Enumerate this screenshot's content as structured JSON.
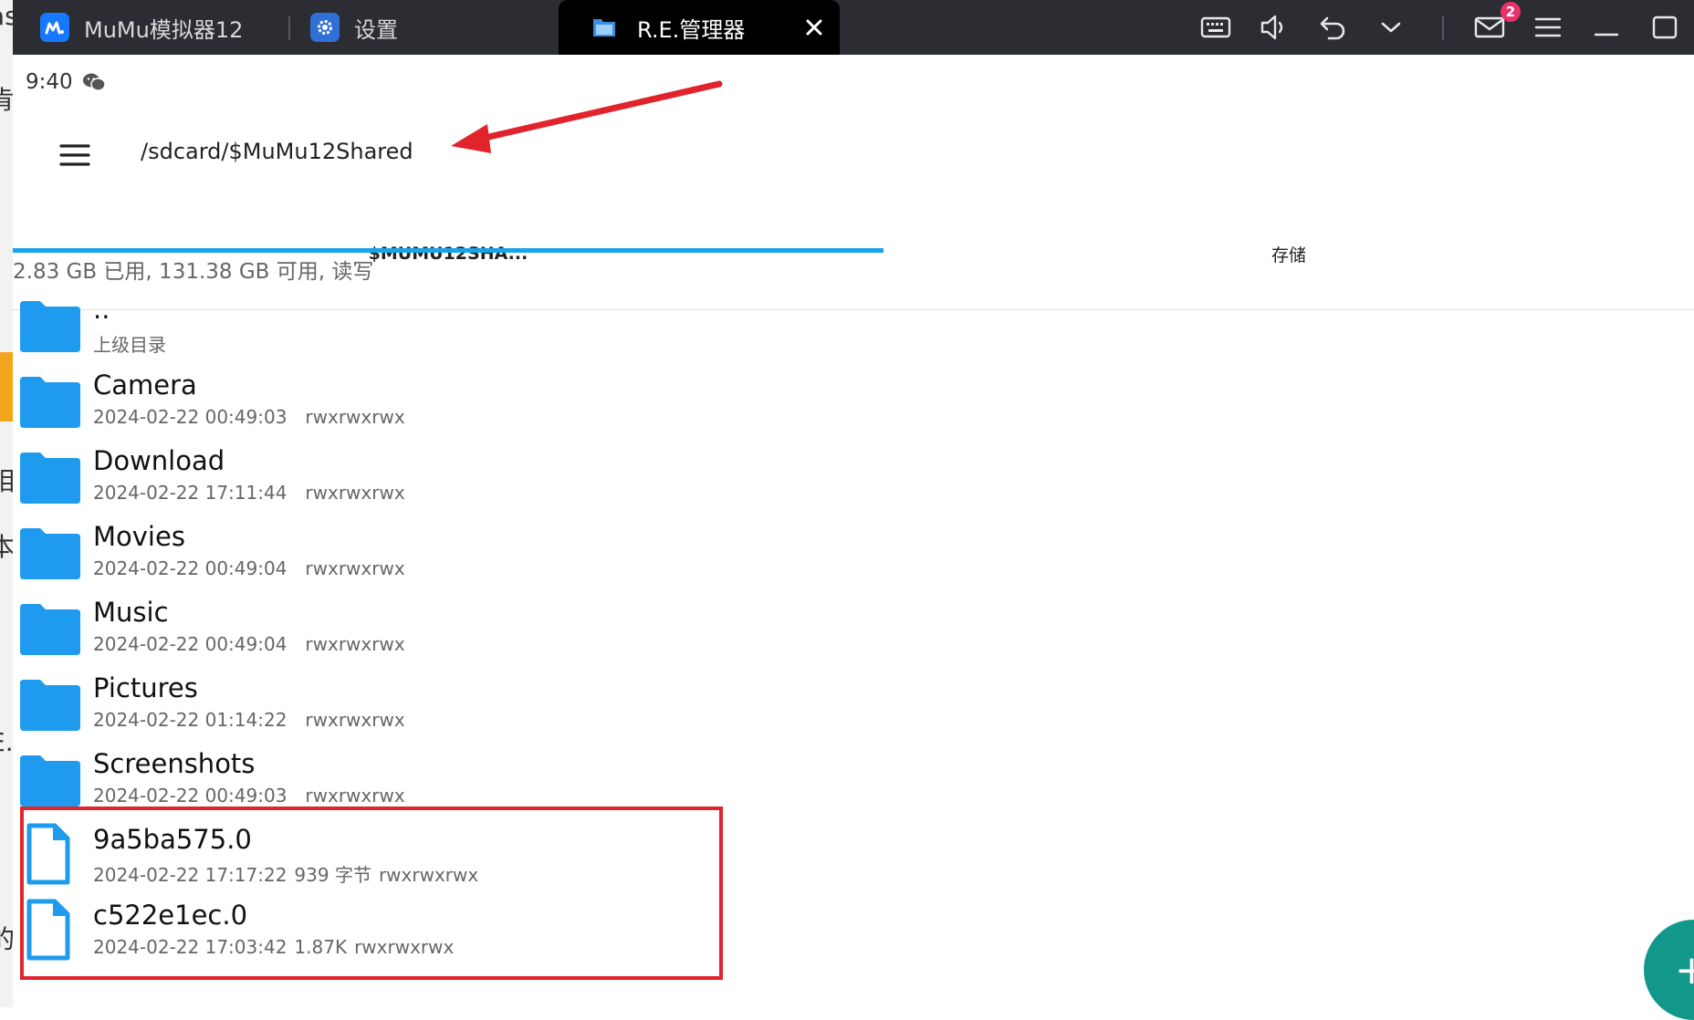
{
  "window": {
    "tabs": [
      {
        "label": "MuMu模拟器12",
        "icon": "mumu-logo-icon"
      },
      {
        "label": "设置",
        "icon": "settings-gear-icon"
      },
      {
        "label": "R.E.管理器",
        "icon": "re-explorer-icon",
        "active": true
      }
    ],
    "toolbar_icons": [
      "keyboard-icon",
      "volume-icon",
      "back-undo-icon",
      "chevron-down-icon",
      "mail-icon",
      "hamburger-menu-icon",
      "minimize-icon",
      "maximize-icon"
    ],
    "mail_badge_count": "2"
  },
  "left_strip_glyphs": [
    "as",
    "肯",
    "相",
    "本",
    "·",
    "E.",
    "的"
  ],
  "status_bar": {
    "time": "9:40",
    "notification_icon": "wechat-icon"
  },
  "app_bar": {
    "path": "/sdcard/$MuMu12Shared"
  },
  "location_tabs": [
    {
      "label": "$MUMU12SHA...",
      "active": true
    },
    {
      "label": "存储",
      "active": false
    }
  ],
  "storage_info": "2.83 GB 已用, 131.38 GB 可用, 读写",
  "entries": [
    {
      "name": "..",
      "meta": [
        "上级目录"
      ],
      "type": "folder"
    },
    {
      "name": "Camera",
      "meta": [
        "2024-02-22 00:49:03",
        "rwxrwxrwx"
      ],
      "type": "folder"
    },
    {
      "name": "Download",
      "meta": [
        "2024-02-22 17:11:44",
        "rwxrwxrwx"
      ],
      "type": "folder"
    },
    {
      "name": "Movies",
      "meta": [
        "2024-02-22 00:49:04",
        "rwxrwxrwx"
      ],
      "type": "folder"
    },
    {
      "name": "Music",
      "meta": [
        "2024-02-22 00:49:04",
        "rwxrwxrwx"
      ],
      "type": "folder"
    },
    {
      "name": "Pictures",
      "meta": [
        "2024-02-22 01:14:22",
        "rwxrwxrwx"
      ],
      "type": "folder"
    },
    {
      "name": "Screenshots",
      "meta": [
        "2024-02-22 00:49:03",
        "rwxrwxrwx"
      ],
      "type": "folder"
    },
    {
      "name": "9a5ba575.0",
      "meta": [
        "2024-02-22 17:17:22",
        "939 字节",
        "rwxrwxrwx"
      ],
      "type": "file"
    },
    {
      "name": "c522e1ec.0",
      "meta": [
        "2024-02-22 17:03:42",
        "1.87K",
        "rwxrwxrwx"
      ],
      "type": "file"
    }
  ],
  "fab_symbol": "+",
  "colors": {
    "topbar": "#2b2d32",
    "folder_blue": "#1e9bee",
    "tab_indicator": "#1aa3e8",
    "annotation_red": "#e1242c",
    "fab": "#12988a",
    "badge": "#e8326a"
  }
}
